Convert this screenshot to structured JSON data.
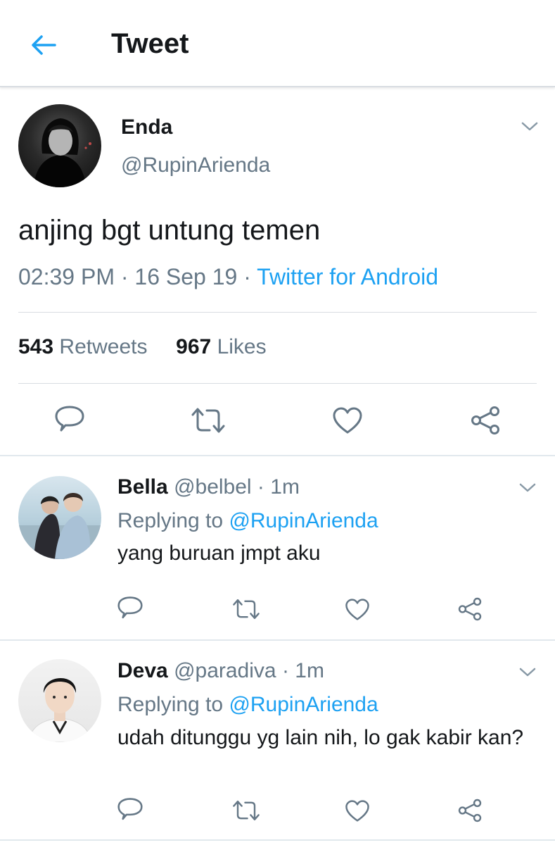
{
  "header": {
    "title": "Tweet",
    "back_icon": "arrow-left-icon",
    "accent": "#1da1f2"
  },
  "tweet": {
    "name": "Enda",
    "handle": "@RupinArienda",
    "text": "anjing bgt untung temen",
    "time": "02:39 PM",
    "date": "16 Sep 19",
    "source": "Twitter for Android",
    "retweets_count": "543",
    "retweets_label": "Retweets",
    "likes_count": "967",
    "likes_label": "Likes"
  },
  "replies": [
    {
      "name": "Bella",
      "handle": "@belbel",
      "time": "1m",
      "replying_label": "Replying to",
      "replying_to": "@RupinArienda",
      "text": "yang buruan jmpt aku"
    },
    {
      "name": "Deva",
      "handle": "@paradiva",
      "time": "1m",
      "replying_label": "Replying to",
      "replying_to": "@RupinArienda",
      "text": "udah ditunggu yg lain nih, lo gak kabir kan?"
    }
  ],
  "colors": {
    "text": "#14171a",
    "secondary": "#657786",
    "link": "#1da1f2",
    "divider": "#e1e8ed"
  }
}
